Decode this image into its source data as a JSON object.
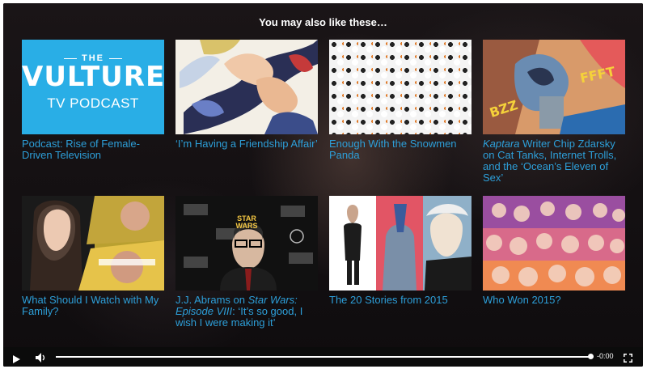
{
  "overlay": {
    "title": "You may also like these…"
  },
  "cards": [
    {
      "caption": "Podcast: Rise of Female-Driven Television",
      "thumb": {
        "the": "THE",
        "brand": "VULTURE",
        "sub": "TV PODCAST"
      }
    },
    {
      "caption": "‘I’m Having a Friendship Affair’"
    },
    {
      "caption": "Enough With the Snowmen Panda"
    },
    {
      "caption_italic": "Kaptara",
      "caption": " Writer Chip Zdarsky on Cat Tanks, Internet Trolls, and the ‘Ocean’s Eleven of Sex’",
      "thumb": {
        "fx1": "BZZ",
        "fx2": "FFFT"
      }
    },
    {
      "caption": "What Should I Watch with My Family?"
    },
    {
      "caption_pre": "J.J. Abrams on ",
      "caption_italic": "Star Wars: Episode VIII",
      "caption": ": ‘It’s so good, I wish I were making it’",
      "thumb": {
        "logo": "STAR WARS"
      }
    },
    {
      "caption": "The 20 Stories from 2015"
    },
    {
      "caption": "Who Won 2015?"
    }
  ],
  "controls": {
    "time": "-0:00",
    "icons": [
      "play-icon",
      "volume-icon",
      "fullscreen-icon"
    ],
    "progress_fraction": 1.0
  },
  "colors": {
    "caption": "#2d9fd9",
    "vulture_bg": "#29aee6"
  }
}
